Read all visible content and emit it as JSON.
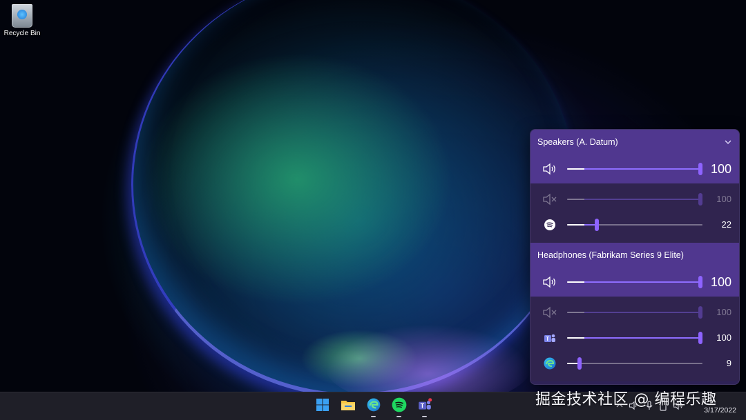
{
  "desktop": {
    "recycle_bin_label": "Recycle Bin"
  },
  "flyout": {
    "devices": [
      {
        "title": "Speakers (A. Datum)",
        "master_value": "100",
        "master_level": 1.0,
        "apps": [
          {
            "icon": "system-sounds-muted-icon",
            "value": "100",
            "level": 1.0,
            "dimmed": true
          },
          {
            "icon": "spotify-icon",
            "value": "22",
            "level": 0.22,
            "dimmed": false
          }
        ]
      },
      {
        "title": "Headphones (Fabrikam Series 9 Elite)",
        "master_value": "100",
        "master_level": 1.0,
        "apps": [
          {
            "icon": "system-sounds-muted-icon",
            "value": "100",
            "level": 1.0,
            "dimmed": true
          },
          {
            "icon": "teams-icon",
            "value": "100",
            "level": 1.0,
            "dimmed": false
          },
          {
            "icon": "edge-icon",
            "value": "9",
            "level": 0.09,
            "dimmed": false
          }
        ]
      }
    ]
  },
  "taskbar": {
    "apps": [
      "start-icon",
      "file-explorer-icon",
      "edge-icon",
      "spotify-icon",
      "teams-icon"
    ],
    "date": "3/17/2022"
  },
  "watermark": "掘金技术社区 @ 编程乐趣",
  "colors": {
    "accent": "#8e63ff",
    "header": "#50378f",
    "panel": "#30244f"
  }
}
